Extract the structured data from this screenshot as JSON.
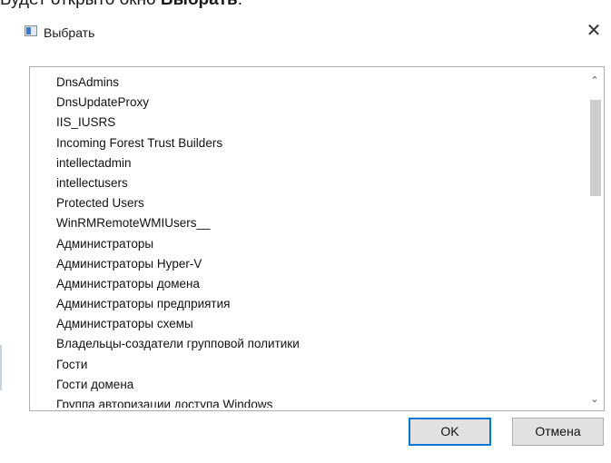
{
  "caption": {
    "prefix": "Будет открыто окно ",
    "bold": "Выбрать",
    "suffix": "."
  },
  "dialog": {
    "title": "Выбрать",
    "close_glyph": "✕",
    "list_items": [
      "DnsAdmins",
      "DnsUpdateProxy",
      "IIS_IUSRS",
      "Incoming Forest Trust Builders",
      "intellectadmin",
      "intellectusers",
      "Protected Users",
      "WinRMRemoteWMIUsers__",
      "Администраторы",
      "Администраторы Hyper-V",
      "Администраторы домена",
      "Администраторы предприятия",
      "Администраторы схемы",
      "Владельцы-создатели групповой политики",
      "Гости",
      "Гости домена",
      "Группа авторизации доступа Windows"
    ],
    "scroll_up_glyph": "⌃",
    "scroll_down_glyph": "⌄",
    "ok_label": "OK",
    "cancel_label": "Отмена"
  }
}
